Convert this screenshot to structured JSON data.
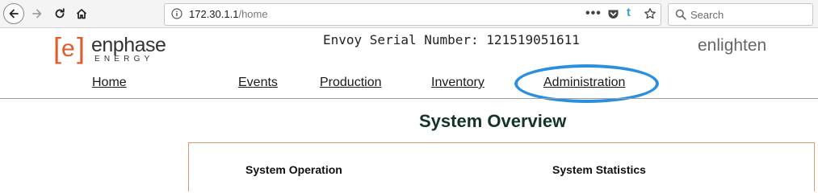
{
  "browser": {
    "url_host": "172.30.1.1",
    "url_path": "/home",
    "search_placeholder": "Search",
    "more_label": "•••",
    "tumblr_label": "t"
  },
  "header": {
    "logo_bracket_open": "[",
    "logo_letter": "e",
    "logo_bracket_close": "]",
    "logo_name": "enphase",
    "logo_sub": "ENERGY",
    "serial_label": "Envoy Serial Number: 121519051611",
    "brand_right": "enlighten"
  },
  "nav": {
    "items": [
      {
        "label": "Home"
      },
      {
        "label": "Events"
      },
      {
        "label": "Production"
      },
      {
        "label": "Inventory"
      },
      {
        "label": "Administration"
      }
    ],
    "highlight_color": "#2b8fe0"
  },
  "main": {
    "title": "System Overview",
    "panels": [
      {
        "heading": "System Operation"
      },
      {
        "heading": "System Statistics"
      }
    ]
  },
  "colors": {
    "brand": "#e05a2b",
    "panel_border": "#e29a73",
    "title": "#14332a"
  }
}
